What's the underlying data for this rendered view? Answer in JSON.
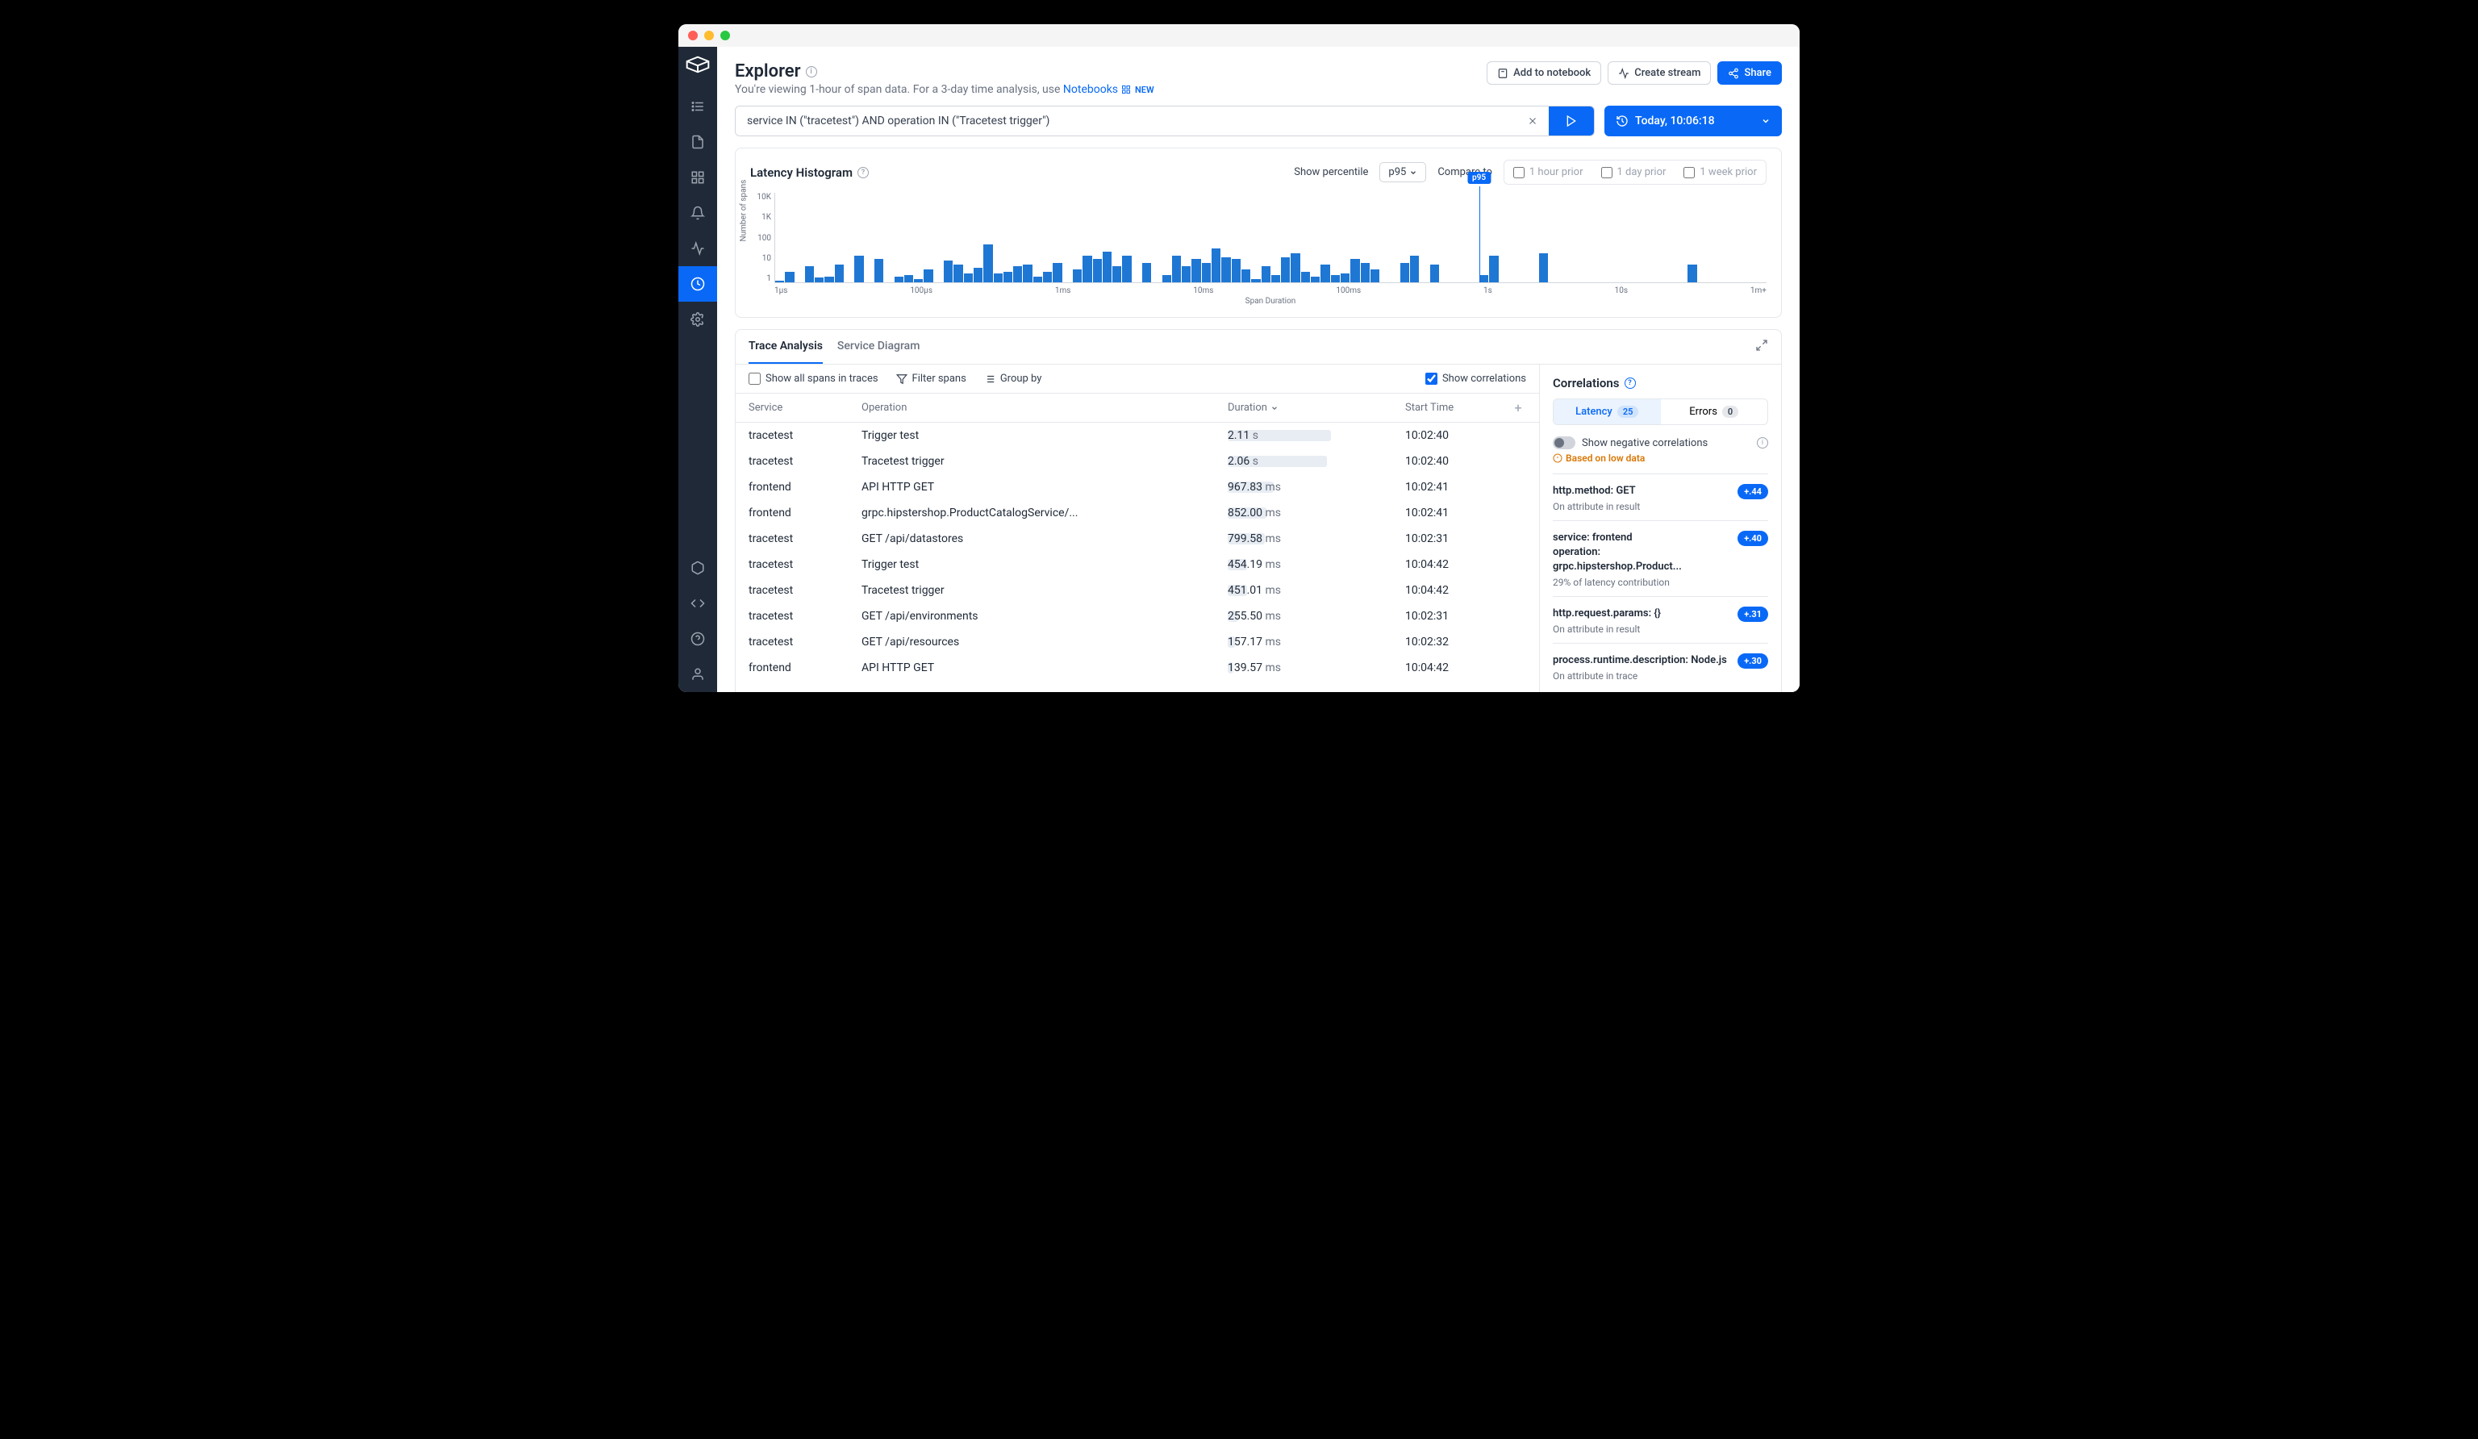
{
  "header": {
    "title": "Explorer",
    "subtitle_prefix": "You're viewing 1-hour of span data. For a 3-day time analysis, use ",
    "subtitle_link": "Notebooks",
    "new_badge": "NEW",
    "add_notebook": "Add to notebook",
    "create_stream": "Create stream",
    "share": "Share"
  },
  "query": {
    "value": "service IN (\"tracetest\") AND operation IN (\"Tracetest trigger\")",
    "time": "Today, 10:06:18"
  },
  "histogram": {
    "title": "Latency Histogram",
    "show_percentile": "Show percentile",
    "percentile": "p95",
    "compare_to": "Compare to",
    "compare_options": [
      "1 hour prior",
      "1 day prior",
      "1 week prior"
    ],
    "y_label": "Number of spans",
    "x_label": "Span Duration",
    "p95_label": "p95",
    "y_ticks": [
      "10K",
      "1K",
      "100",
      "10",
      "1"
    ],
    "x_ticks": [
      "1µs",
      "100µs",
      "1ms",
      "10ms",
      "100ms",
      "1s",
      "10s",
      "1m+"
    ]
  },
  "chart_data": {
    "type": "bar",
    "title": "Latency Histogram",
    "xlabel": "Span Duration",
    "ylabel": "Number of spans",
    "y_scale": "log",
    "ylim": [
      1,
      10000
    ],
    "x_ticks": [
      "1µs",
      "100µs",
      "1ms",
      "10ms",
      "100ms",
      "1s",
      "10s",
      "1m+"
    ],
    "p95_position_pct": 71,
    "bars_height_pct": [
      2,
      12,
      0,
      18,
      5,
      6,
      20,
      0,
      30,
      0,
      26,
      0,
      6,
      8,
      4,
      14,
      0,
      24,
      20,
      10,
      16,
      42,
      10,
      12,
      18,
      20,
      6,
      12,
      22,
      0,
      14,
      30,
      26,
      34,
      18,
      30,
      0,
      22,
      0,
      8,
      30,
      18,
      26,
      22,
      38,
      28,
      26,
      14,
      4,
      18,
      8,
      28,
      32,
      12,
      6,
      20,
      8,
      10,
      26,
      22,
      14,
      0,
      0,
      22,
      30,
      0,
      20,
      0,
      0,
      0,
      0,
      8,
      30,
      0,
      0,
      0,
      0,
      32,
      0,
      0,
      0,
      0,
      0,
      0,
      0,
      0,
      0,
      0,
      0,
      0,
      0,
      0,
      20,
      0,
      0,
      0,
      0,
      0,
      0,
      0
    ]
  },
  "tabs": {
    "trace_analysis": "Trace Analysis",
    "service_diagram": "Service Diagram"
  },
  "toolbar": {
    "show_all": "Show all spans in traces",
    "filter": "Filter spans",
    "group": "Group by",
    "show_corr": "Show correlations"
  },
  "columns": {
    "service": "Service",
    "operation": "Operation",
    "duration": "Duration",
    "start": "Start Time"
  },
  "rows": [
    {
      "service": "tracetest",
      "op": "Trigger test",
      "dur_val": "2.11",
      "dur_unit": "s",
      "dur_pct": 58,
      "start": "10:02:40"
    },
    {
      "service": "tracetest",
      "op": "Tracetest trigger",
      "dur_val": "2.06",
      "dur_unit": "s",
      "dur_pct": 56,
      "start": "10:02:40"
    },
    {
      "service": "frontend",
      "op": "API HTTP GET",
      "dur_val": "967.83",
      "dur_unit": "ms",
      "dur_pct": 26,
      "start": "10:02:41"
    },
    {
      "service": "frontend",
      "op": "grpc.hipstershop.ProductCatalogService/...",
      "dur_val": "852.00",
      "dur_unit": "ms",
      "dur_pct": 22,
      "start": "10:02:41"
    },
    {
      "service": "tracetest",
      "op": "GET /api/datastores",
      "dur_val": "799.58",
      "dur_unit": "ms",
      "dur_pct": 21,
      "start": "10:02:31"
    },
    {
      "service": "tracetest",
      "op": "Trigger test",
      "dur_val": "454.19",
      "dur_unit": "ms",
      "dur_pct": 11,
      "start": "10:04:42"
    },
    {
      "service": "tracetest",
      "op": "Tracetest trigger",
      "dur_val": "451.01",
      "dur_unit": "ms",
      "dur_pct": 11,
      "start": "10:04:42"
    },
    {
      "service": "tracetest",
      "op": "GET /api/environments",
      "dur_val": "255.50",
      "dur_unit": "ms",
      "dur_pct": 6,
      "start": "10:02:31"
    },
    {
      "service": "tracetest",
      "op": "GET /api/resources",
      "dur_val": "157.17",
      "dur_unit": "ms",
      "dur_pct": 4,
      "start": "10:02:32"
    },
    {
      "service": "frontend",
      "op": "API HTTP GET",
      "dur_val": "139.57",
      "dur_unit": "ms",
      "dur_pct": 3,
      "start": "10:04:42"
    }
  ],
  "correlations": {
    "title": "Correlations",
    "latency_tab": "Latency",
    "latency_count": "25",
    "errors_tab": "Errors",
    "errors_count": "0",
    "neg_label": "Show negative correlations",
    "low_data": "Based on low data",
    "items": [
      {
        "title": "http.method: GET",
        "sub": "On attribute in result",
        "score": "+.44"
      },
      {
        "title": "service: frontend\noperation: grpc.hipstershop.Product...",
        "sub": "29% of latency contribution",
        "score": "+.40"
      },
      {
        "title": "http.request.params: {}",
        "sub": "On attribute in result",
        "score": "+.31"
      },
      {
        "title": "process.runtime.description: Node.js",
        "sub": "On attribute in trace",
        "score": "+.30"
      }
    ]
  }
}
